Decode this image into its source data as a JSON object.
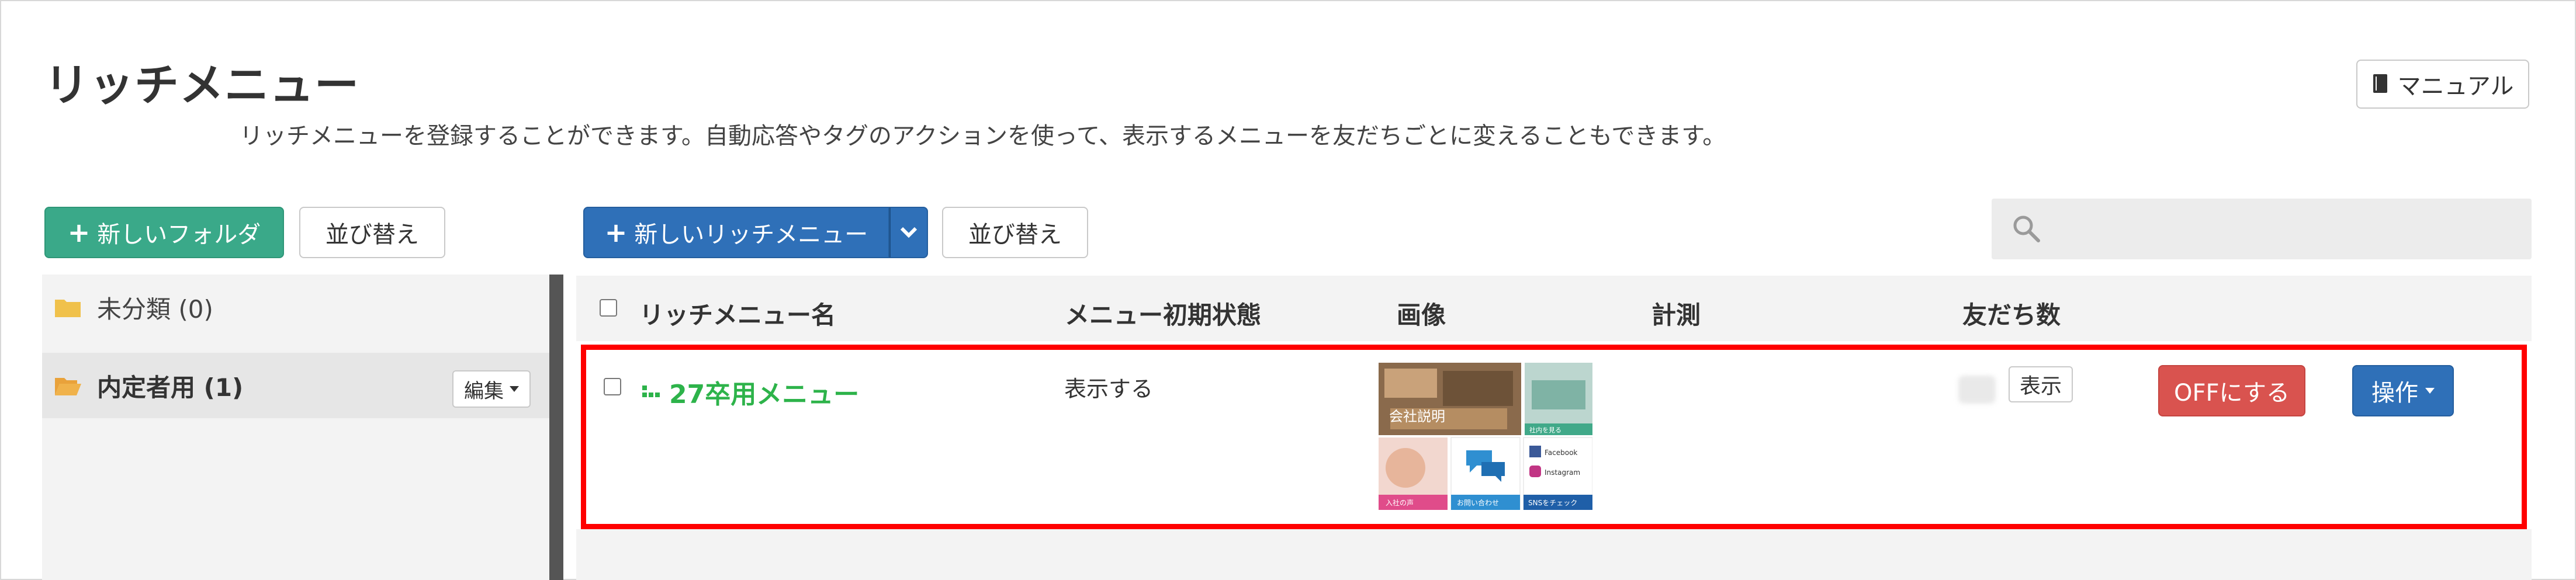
{
  "header": {
    "title": "リッチメニュー",
    "description": "リッチメニューを登録することができます。自動応答やタグのアクションを使って、表示するメニューを友だちごとに変えることもできます。",
    "manual_label": "マニュアル"
  },
  "folders": {
    "new_folder_label": "新しいフォルダ",
    "sort_label": "並び替え",
    "items": [
      {
        "label": "未分類 (0)"
      },
      {
        "label": "内定者用 (1)",
        "edit_label": "編集"
      }
    ]
  },
  "toolbar": {
    "new_richmenu_label": "新しいリッチメニュー",
    "sort_label": "並び替え"
  },
  "search": {
    "placeholder": ""
  },
  "table": {
    "headers": {
      "name": "リッチメニュー名",
      "initial_state": "メニュー初期状態",
      "image": "画像",
      "measure": "計測",
      "friends": "友だち数"
    },
    "rows": [
      {
        "name": "27卒用メニュー",
        "initial_state": "表示する",
        "measure": "",
        "show_label": "表示",
        "off_label": "OFFにする",
        "operate_label": "操作"
      }
    ]
  },
  "thumbnail": {
    "caption_a": "会社説明",
    "caption_b": "社内を見る",
    "caption_c": "入社の声",
    "caption_d": "お問い合わせ",
    "social_fb": "Facebook",
    "social_ig": "Instagram",
    "social_cta": "SNSをチェック"
  },
  "colors": {
    "green": "#3aa989",
    "blue": "#2f70b8",
    "red": "#d9534f",
    "highlight": "#ff0000",
    "menu_name": "#2db34a"
  }
}
